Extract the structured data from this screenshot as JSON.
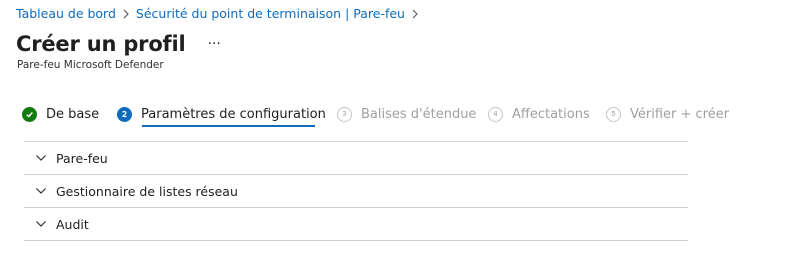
{
  "breadcrumb": {
    "items": [
      "Tableau de bord",
      "Sécurité du point de terminaison | Pare-feu"
    ]
  },
  "header": {
    "title": "Créer un profil",
    "more_label": "...",
    "subtitle": "Pare-feu Microsoft Defender"
  },
  "wizard": {
    "steps": [
      {
        "number": "1",
        "label": "De base",
        "state": "done"
      },
      {
        "number": "2",
        "label": "Paramètres de configuration",
        "state": "active"
      },
      {
        "number": "3",
        "label": "Balises d'étendue",
        "state": "pending"
      },
      {
        "number": "4",
        "label": "Affectations",
        "state": "pending"
      },
      {
        "number": "5",
        "label": "Vérifier + créer",
        "state": "pending"
      }
    ]
  },
  "sections": [
    {
      "label": "Pare-feu"
    },
    {
      "label": "Gestionnaire de listes réseau"
    },
    {
      "label": "Audit"
    }
  ],
  "colors": {
    "link": "#0f6cbd",
    "accent": "#0f6cbd",
    "success": "#107c10",
    "muted": "#a19f9d"
  }
}
